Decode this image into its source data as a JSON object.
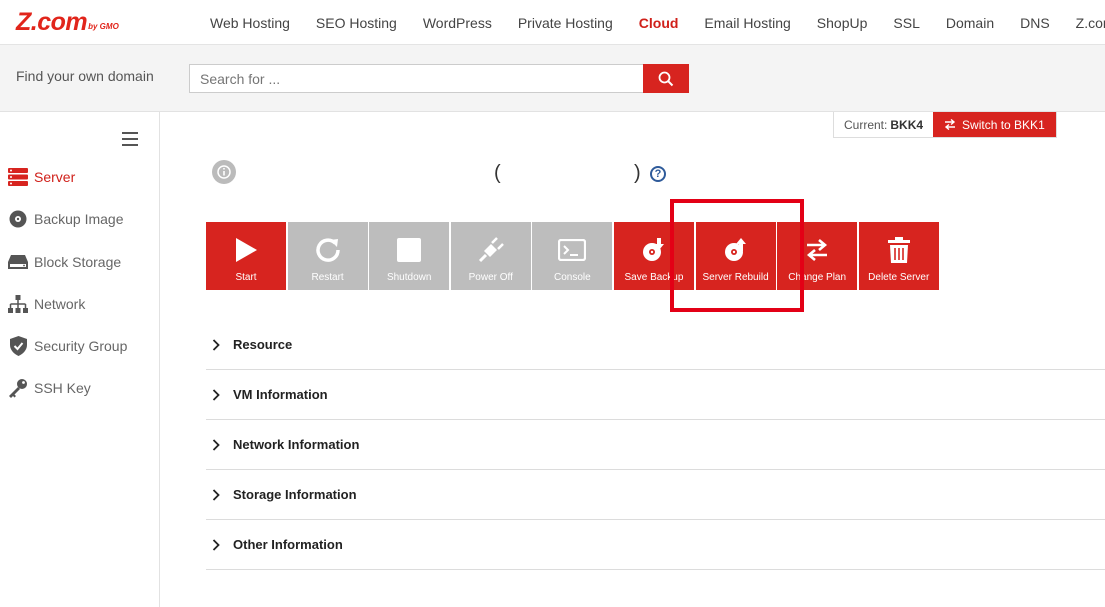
{
  "brand": {
    "logo_text": "Z.com",
    "logo_sub": "by GMO",
    "accent": "#d7241f"
  },
  "nav": {
    "items": [
      {
        "label": "Web Hosting"
      },
      {
        "label": "SEO Hosting"
      },
      {
        "label": "WordPress"
      },
      {
        "label": "Private Hosting"
      },
      {
        "label": "Cloud",
        "active": true
      },
      {
        "label": "Email Hosting"
      },
      {
        "label": "ShopUp"
      },
      {
        "label": "SSL"
      },
      {
        "label": "Domain"
      },
      {
        "label": "DNS"
      },
      {
        "label": "Z.com S"
      }
    ]
  },
  "domain_search": {
    "label": "Find your own domain",
    "placeholder": "Search for ...",
    "button_icon": "search-icon"
  },
  "sidebar": {
    "items": [
      {
        "label": "Server",
        "icon": "server-icon",
        "active": true
      },
      {
        "label": "Backup Image",
        "icon": "disk-icon"
      },
      {
        "label": "Block Storage",
        "icon": "storage-icon"
      },
      {
        "label": "Network",
        "icon": "network-icon"
      },
      {
        "label": "Security Group",
        "icon": "shield-icon"
      },
      {
        "label": "SSH Key",
        "icon": "key-icon"
      }
    ]
  },
  "datacenter": {
    "current_label": "Current:",
    "current_value": "BKK4",
    "switch_label": "Switch to BKK1"
  },
  "server": {
    "paren_open": "(",
    "paren_close": ")",
    "help": "?"
  },
  "actions": [
    {
      "label": "Start",
      "icon": "play-icon",
      "enabled": true
    },
    {
      "label": "Restart",
      "icon": "restart-icon",
      "enabled": false
    },
    {
      "label": "Shutdown",
      "icon": "stop-icon",
      "enabled": false
    },
    {
      "label": "Power Off",
      "icon": "plug-icon",
      "enabled": false
    },
    {
      "label": "Console",
      "icon": "console-icon",
      "enabled": false
    },
    {
      "label": "Save Backup",
      "icon": "backup-icon",
      "enabled": true
    },
    {
      "label": "Server Rebuild",
      "icon": "rebuild-icon",
      "enabled": true
    },
    {
      "label": "Change Plan",
      "icon": "swap-icon",
      "enabled": true
    },
    {
      "label": "Delete Server",
      "icon": "trash-icon",
      "enabled": true
    }
  ],
  "sections": [
    {
      "title": "Resource"
    },
    {
      "title": "VM Information"
    },
    {
      "title": "Network Information"
    },
    {
      "title": "Storage Information"
    },
    {
      "title": "Other Information"
    }
  ]
}
